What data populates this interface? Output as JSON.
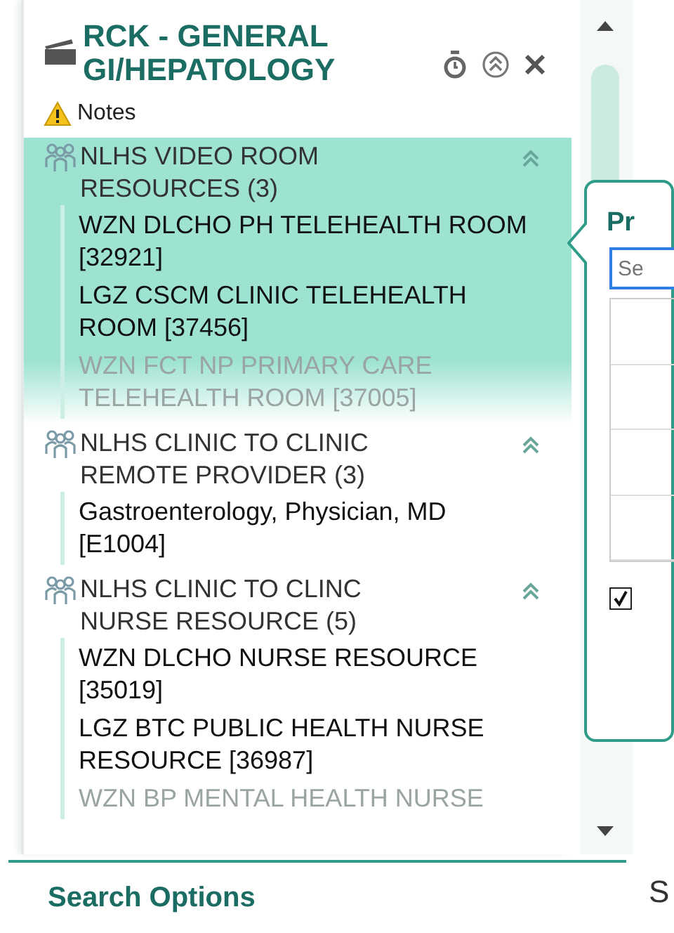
{
  "header": {
    "title": "RCK - GENERAL GI/HEPATOLOGY"
  },
  "notes": {
    "label": "Notes"
  },
  "groups": [
    {
      "label": "NLHS VIDEO ROOM RESOURCES (3)",
      "selected": true,
      "expanded": true,
      "items": [
        {
          "label": "WZN DLCHO PH TELEHEALTH ROOM [32921]",
          "faded": false
        },
        {
          "label": "LGZ CSCM CLINIC TELEHEALTH ROOM [37456]",
          "faded": false
        },
        {
          "label": "WZN FCT NP PRIMARY CARE TELEHEALTH ROOM [37005]",
          "faded": true
        }
      ]
    },
    {
      "label": "NLHS CLINIC TO CLINIC REMOTE PROVIDER (3)",
      "selected": false,
      "expanded": true,
      "items": [
        {
          "label": "Gastroenterology, Physician, MD [E1004]",
          "faded": false
        }
      ]
    },
    {
      "label": "NLHS CLINIC TO CLINC NURSE RESOURCE (5)",
      "selected": false,
      "expanded": true,
      "items": [
        {
          "label": "WZN DLCHO NURSE RESOURCE [35019]",
          "faded": false
        },
        {
          "label": "LGZ BTC PUBLIC HEALTH NURSE RESOURCE [36987]",
          "faded": false
        },
        {
          "label": "WZN BP MENTAL HEALTH NURSE",
          "faded": true
        }
      ]
    }
  ],
  "popover": {
    "title": "Pr",
    "search": {
      "placeholder": "Se"
    },
    "checkbox": {
      "checked": true
    }
  },
  "footer": {
    "title": "Search Options",
    "side_text": "S"
  }
}
